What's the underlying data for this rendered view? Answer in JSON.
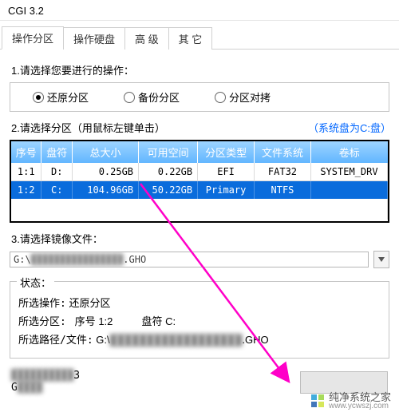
{
  "window": {
    "title": "CGI 3.2"
  },
  "tabs": {
    "items": [
      {
        "label": "操作分区"
      },
      {
        "label": "操作硬盘"
      },
      {
        "label": "高 级"
      },
      {
        "label": "其 它"
      }
    ],
    "active_index": 0
  },
  "section1": {
    "title": "1.请选择您要进行的操作：",
    "options": [
      {
        "label": "还原分区",
        "checked": true
      },
      {
        "label": "备份分区",
        "checked": false
      },
      {
        "label": "分区对拷",
        "checked": false
      }
    ]
  },
  "section2": {
    "title": "2.请选择分区（用鼠标左键单击）",
    "hint": "（系统盘为C:盘）",
    "columns": [
      "序号",
      "盘符",
      "总大小",
      "可用空间",
      "分区类型",
      "文件系统",
      "卷标"
    ],
    "rows": [
      {
        "idx": "1:1",
        "drv": "D:",
        "total": "0.25GB",
        "free": "0.22GB",
        "ptype": "EFI",
        "fs": "FAT32",
        "label": "SYSTEM_DRV",
        "selected": false
      },
      {
        "idx": "1:2",
        "drv": "C:",
        "total": "104.96GB",
        "free": "50.22GB",
        "ptype": "Primary",
        "fs": "NTFS",
        "label": "",
        "selected": true
      }
    ]
  },
  "section3": {
    "title": "3.请选择镜像文件：",
    "path_prefix": "G:\\",
    "path_suffix": ".GHO"
  },
  "status": {
    "legend": "状态：",
    "op_label": "所选操作:",
    "op_value": "还原分区",
    "part_label": "所选分区:",
    "part_idx_label": "序号",
    "part_idx_value": "1:2",
    "part_drv_label": "盘符",
    "part_drv_value": "C:",
    "file_label": "所选路径/文件:",
    "file_prefix": "G:\\",
    "file_suffix": ".GHO"
  },
  "footer": {
    "line1_suffix": "3",
    "line2_prefix": "G"
  },
  "watermark": {
    "name": "纯净系统之家",
    "url": "www.ycwszj.com"
  },
  "colors": {
    "th_grad_top": "#9dd4ff",
    "th_grad_bot": "#62b6ff",
    "row_sel_bg": "#0a6cdc",
    "link_blue": "#0066ff",
    "arrow": "#ff00c8"
  }
}
